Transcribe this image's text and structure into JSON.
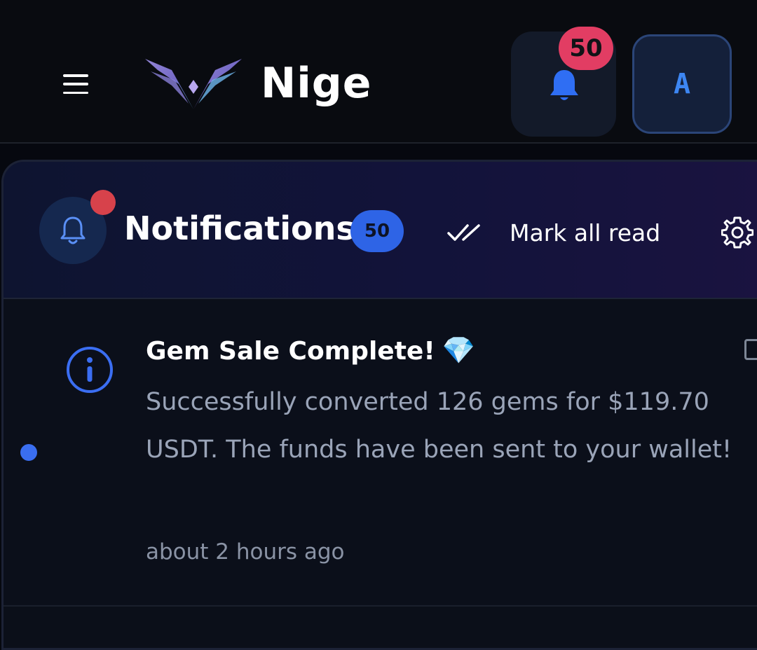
{
  "header": {
    "brand": "Nige",
    "notification_badge": "50",
    "avatar_initial": "A"
  },
  "notifications_panel": {
    "title": "Notifications",
    "count": "50",
    "mark_all_read_label": "Mark all read"
  },
  "items": [
    {
      "title": "Gem Sale Complete!",
      "emoji": "💎",
      "body": "Successfully converted 126 gems for $119.70 USDT. The funds have been sent to your wallet!",
      "time": "about 2 hours ago",
      "unread": true
    }
  ],
  "colors": {
    "accent": "#3a6ef0",
    "badge_red": "#e23d63",
    "background": "#06080f"
  }
}
